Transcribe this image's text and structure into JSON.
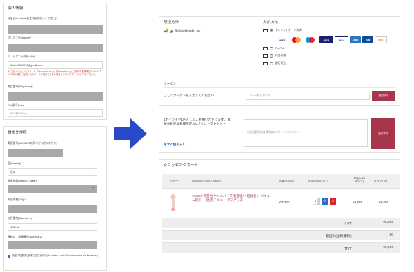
{
  "left": {
    "personal_heading": "個人情報",
    "name_label": "氏名(Full Name/氏名は必ず記入ください)",
    "furigana_label": "フリガナ(Furigana)",
    "email_label": "メールアドレス(E-Mail)",
    "email_value": "tbhdxr0389012@gmail.com",
    "email_note": "※ご記入いただいたアドレス「@docomo.ne.jp」「@ezweb.ne.jp」ご利用の携帯電話のメールアドレスの場合、当店からのメールが受信できない場合がございます。予めご了承ください。",
    "phone_label": "電話番号(Telephone)",
    "fax_label": "FAX番号(Fax)",
    "fax_placeholder": "FAX番号(Fax)",
    "billing_heading": "請求先住所",
    "postal_label": "郵便番号(000-0000の形でご入力ください)",
    "country_label": "国(Country)",
    "country_value": "日本",
    "state_label": "都道府県(Region / State)",
    "city_label": "市区町村(City)",
    "addr1_label": "丁目番地(Address 1)",
    "addr1_value": "4-92-18",
    "addr2_label": "建物名・部屋番号(Address 2)",
    "same_address_label": "お届け先住所と請求先住所は同じ(My delivery and billing addresses are the same.)",
    "required_mark": "*"
  },
  "shipping": {
    "heading": "配送方法",
    "option_label": "配送料(送料無料) - ¥0"
  },
  "payment": {
    "heading": "支払方法",
    "credit_card": "クレジットカード決済",
    "paypal": "PayPal",
    "cod": "代金引換",
    "bank": "銀行振込",
    "brands": [
      "VISA",
      "MC",
      "Maestro",
      "VISA",
      "VISA",
      "AMEX",
      "JCB",
      "DISC"
    ]
  },
  "coupon": {
    "heading": "クーポン",
    "prompt": "ここにクーポンを入力してください",
    "placeholder": "コードを入力する",
    "button": "適用する"
  },
  "points": {
    "text": "1ポイント＝1円としてご利用いただけます。 新規会員登録者様限定200ポイントプレゼント",
    "link": "今すぐ使える！→",
    "placeholder": "新規会員登録者様限定200ポイントプレゼント",
    "button": "適用する"
  },
  "cart": {
    "heading": "ショッピングカート",
    "columns": [
      "イメージ",
      "商品名(PRODUCT NAME)",
      "品番(MODEL)",
      "数量(QUANTITY)",
      "単価(UNIT PRICE)",
      "合計(TOTAL)"
    ],
    "item": {
      "name": "TocCell 乳首 生ケンニバイブ 乳首吸い 延長長＋ バキューム吸引 ＋ 連続 チクニー ラブグッズ",
      "model": "VX736A",
      "qty": "1",
      "unit_price": "¥6,990",
      "total": "¥6,990"
    },
    "subtotal_label": "小計:",
    "subtotal_value": "¥6,990",
    "shipping_label": "配送料(送料無料):",
    "shipping_value": "¥0",
    "total_label": "合計:",
    "total_value": "¥6,990"
  },
  "colors": {
    "accent": "#a8364a",
    "arrow": "#2a49c9",
    "required": "#c0392b",
    "link": "#1f5fb8"
  }
}
